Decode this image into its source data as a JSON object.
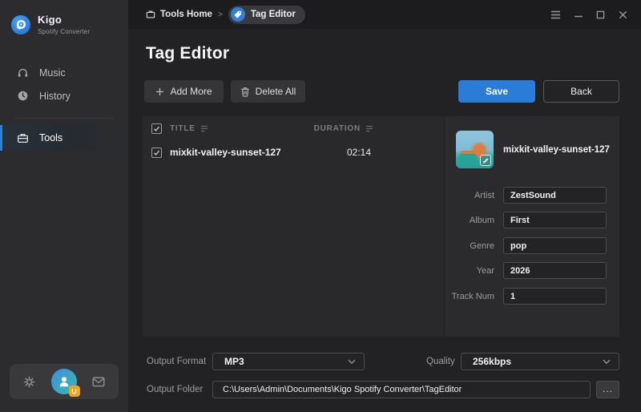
{
  "app": {
    "name": "Kigo",
    "subtitle": "Spotify Converter"
  },
  "sidebar": {
    "items": [
      {
        "label": "Music",
        "icon": "headphones-icon",
        "active": false
      },
      {
        "label": "History",
        "icon": "clock-icon",
        "active": false
      },
      {
        "label": "Tools",
        "icon": "briefcase-icon",
        "active": true
      }
    ],
    "account_icons": [
      "gear-icon",
      "user-avatar",
      "mail-icon"
    ]
  },
  "breadcrumb": {
    "home": "Tools Home",
    "separator": ">",
    "current": "Tag Editor"
  },
  "window_icons": [
    "menu-icon",
    "minimize-icon",
    "maximize-icon",
    "close-icon"
  ],
  "page": {
    "title": "Tag Editor"
  },
  "toolbar": {
    "add_more": "Add More",
    "delete_all": "Delete All",
    "save": "Save",
    "back": "Back"
  },
  "table": {
    "columns": [
      "TITLE",
      "DURATION"
    ],
    "select_all_checked": true,
    "rows": [
      {
        "checked": true,
        "title": "mixkit-valley-sunset-127",
        "duration": "02:14"
      }
    ]
  },
  "detail": {
    "track_title": "mixkit-valley-sunset-127",
    "fields": [
      {
        "label": "Artist",
        "value": "ZestSound"
      },
      {
        "label": "Album",
        "value": "First"
      },
      {
        "label": "Genre",
        "value": "pop"
      },
      {
        "label": "Year",
        "value": "2026"
      },
      {
        "label": "Track Num",
        "value": "1"
      }
    ]
  },
  "output": {
    "format_label": "Output Format",
    "format_value": "MP3",
    "quality_label": "Quality",
    "quality_value": "256kbps",
    "folder_label": "Output Folder",
    "folder_value": "C:\\Users\\Admin\\Documents\\Kigo Spotify Converter\\TagEditor",
    "browse": "..."
  },
  "colors": {
    "accent_blue": "#2b7cd6",
    "badge_orange": "#f2a41c",
    "panel_bg": "#29292c",
    "sidebar_bg": "#2c2c2e"
  }
}
